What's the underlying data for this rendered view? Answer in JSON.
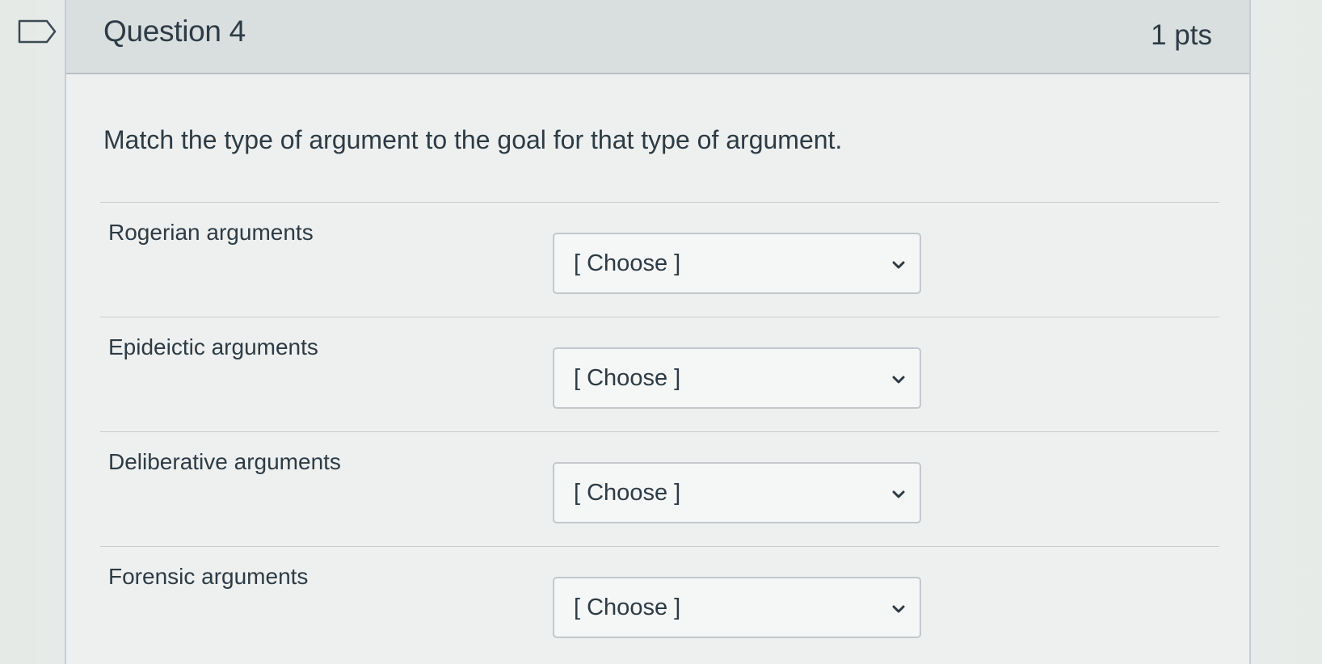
{
  "question": {
    "title": "Question 4",
    "points": "1 pts",
    "prompt": "Match the type of argument to the goal for that type of argument."
  },
  "matches": [
    {
      "label": "Rogerian arguments",
      "selected": "[ Choose ]"
    },
    {
      "label": "Epideictic arguments",
      "selected": "[ Choose ]"
    },
    {
      "label": "Deliberative arguments",
      "selected": "[ Choose ]"
    },
    {
      "label": "Forensic arguments",
      "selected": "[ Choose ]"
    }
  ],
  "icons": {
    "flag": "flag-question-icon",
    "dropdown": "chevron-down-icon"
  },
  "colors": {
    "text": "#2d3b45",
    "header_bg": "#d9dedf",
    "border": "#c2c8cc"
  }
}
